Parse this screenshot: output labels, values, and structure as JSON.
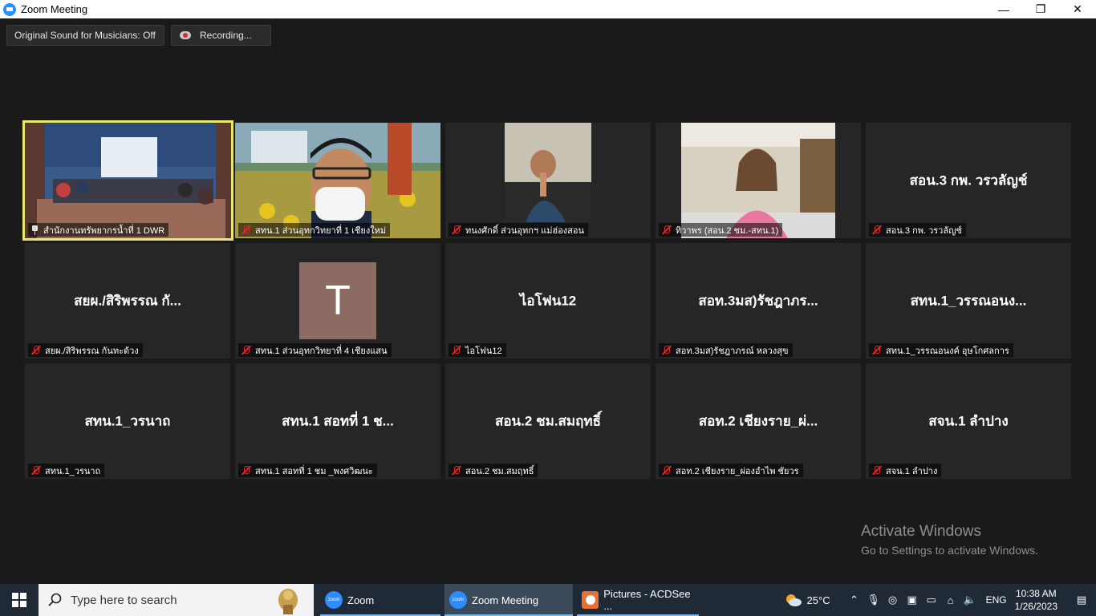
{
  "window": {
    "title": "Zoom Meeting",
    "minimize": "—",
    "restore": "❐",
    "close": "✕"
  },
  "top_buttons": {
    "original_sound": "Original Sound for Musicians: Off",
    "recording": "Recording..."
  },
  "participants": [
    {
      "label": "สำนักงานทรัพยากรน้ำที่ 1 DWR",
      "center": "",
      "video": true,
      "pinned": true
    },
    {
      "label": "สทน.1 ส่วนอุทกวิทยาที่ 1 เชียงใหม่",
      "center": "",
      "video": true
    },
    {
      "label": "ทนงศักดิ์ ส่วนอุทกฯ แม่ฮ่องสอน",
      "center": "",
      "video": true
    },
    {
      "label": "ทิวาพร (สอน.2 ชม.-สทน.1)",
      "center": "",
      "video": true
    },
    {
      "label": "สอน.3 กพ. วรวลัญช์",
      "center": "สอน.3 กพ. วรวลัญช์"
    },
    {
      "label": "สยผ./สิริพรรณ กันทะด้วง",
      "center": "สยผ./สิริพรรณ กั..."
    },
    {
      "label": "สทน.1 ส่วนอุทกวิทยาที่ 4 เชียงแสน",
      "center": "T",
      "avatar": true
    },
    {
      "label": "ไอโฟน12",
      "center": "ไอโฟน12"
    },
    {
      "label": "สอท.3มส)รัชฎาภรณ์ หลวงสุข",
      "center": "สอท.3มส)รัชฎาภร..."
    },
    {
      "label": "สทน.1_วรรณอนงค์ อุษโกศลการ",
      "center": "สทน.1_วรรณอนง..."
    },
    {
      "label": "สทน.1_วรนาถ",
      "center": "สทน.1_วรนาถ"
    },
    {
      "label": "สทน.1 สอทที่ 1 ชม _พงศวิฒนะ",
      "center": "สทน.1 สอทที่ 1 ช..."
    },
    {
      "label": "สอน.2 ชม.สมฤทธิ์",
      "center": "สอน.2 ชม.สมฤทธิ์"
    },
    {
      "label": "สอท.2 เชียงราย_ผ่องอำไพ ชัยวร",
      "center": "สอท.2 เชียงราย_ผ่..."
    },
    {
      "label": "สจน.1 ลำปาง",
      "center": "สจน.1 ลำปาง"
    }
  ],
  "watermark": {
    "line1": "Activate Windows",
    "line2": "Go to Settings to activate Windows."
  },
  "taskbar": {
    "search_placeholder": "Type here to search",
    "items": [
      "Zoom",
      "Zoom Meeting",
      "Pictures - ACDSee ..."
    ],
    "weather": "25°C",
    "language": "ENG",
    "time": "10:38 AM",
    "date": "1/26/2023"
  },
  "colors": {
    "active_speaker_border": "#e8e86a",
    "zoom_blue": "#2d8cff",
    "muted_red": "#e02828",
    "tile_bg": "#262626",
    "taskbar_bg": "#1f2a36"
  }
}
